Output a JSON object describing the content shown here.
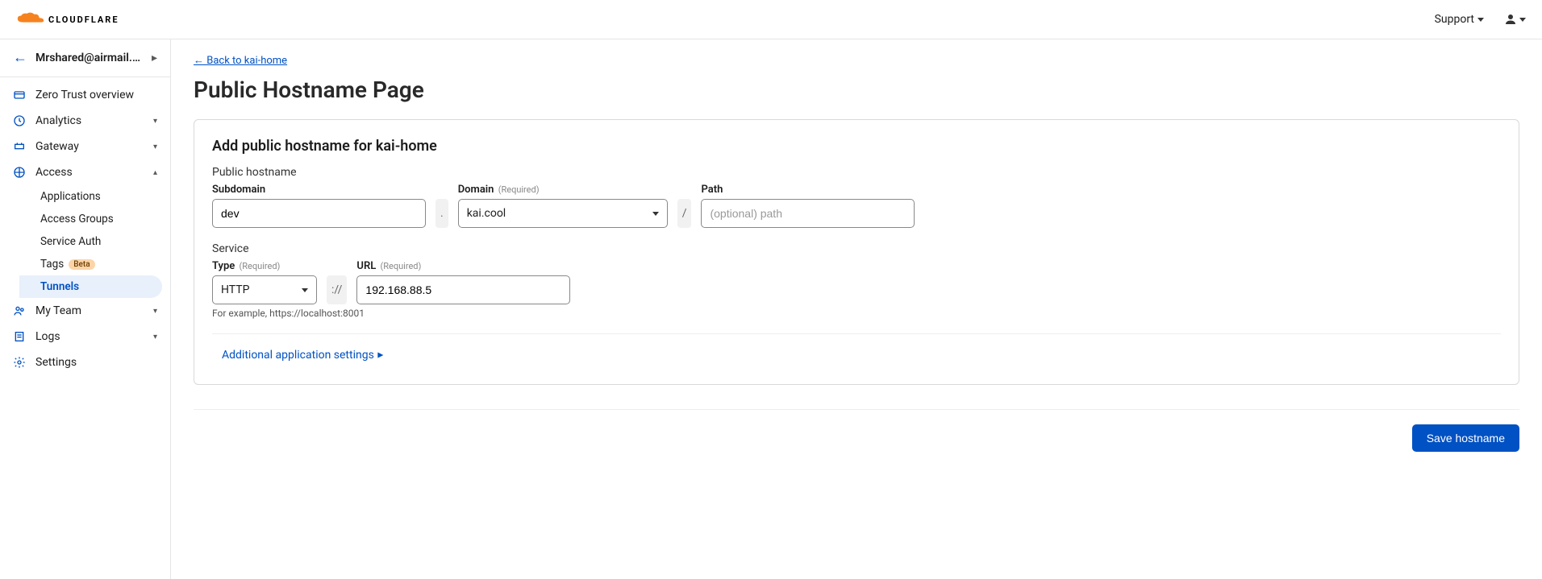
{
  "header": {
    "logo_text": "CLOUDFLARE",
    "support": "Support"
  },
  "sidebar": {
    "account": "Mrshared@airmail.cc...",
    "items": {
      "overview": "Zero Trust overview",
      "analytics": "Analytics",
      "gateway": "Gateway",
      "access": "Access",
      "my_team": "My Team",
      "logs": "Logs",
      "settings": "Settings"
    },
    "access_sub": {
      "applications": "Applications",
      "access_groups": "Access Groups",
      "service_auth": "Service Auth",
      "tags": "Tags",
      "tags_badge": "Beta",
      "tunnels": "Tunnels"
    }
  },
  "main": {
    "back_link": "← Back to kai-home",
    "title": "Public Hostname Page",
    "card_title": "Add public hostname for kai-home",
    "hostname_section_label": "Public hostname",
    "subdomain_label": "Subdomain",
    "subdomain_value": "dev",
    "domain_label": "Domain",
    "domain_value": "kai.cool",
    "path_label": "Path",
    "path_placeholder": "(optional) path",
    "required": "(Required)",
    "dot": ".",
    "slash": "/",
    "service_section_label": "Service",
    "type_label": "Type",
    "type_value": "HTTP",
    "scheme_sep": "://",
    "url_label": "URL",
    "url_value": "192.168.88.5",
    "helper": "For example, https://localhost:8001",
    "additional": "Additional application settings",
    "save": "Save hostname"
  }
}
